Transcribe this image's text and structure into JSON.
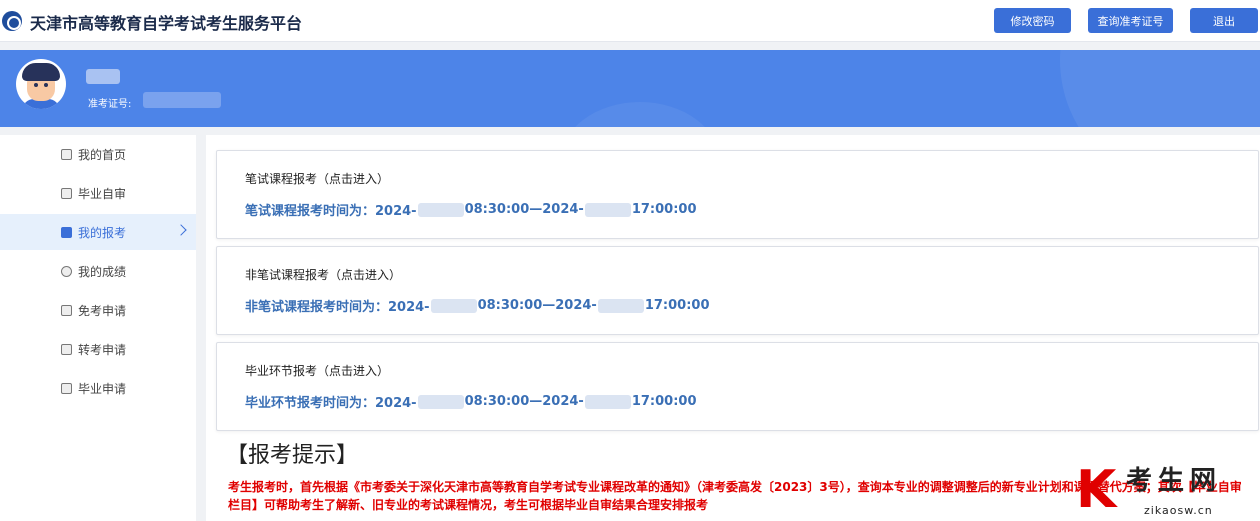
{
  "header": {
    "title": "天津市高等教育自学考试考生服务平台",
    "buttons": {
      "change_password": "修改密码",
      "query_ticket": "查询准考证号",
      "logout": "退出"
    }
  },
  "profile": {
    "ticket_label": "准考证号:"
  },
  "colors": {
    "brand_blue": "#4d84e8",
    "button_blue": "#3a6fd8",
    "link_blue": "#3a6fb5",
    "alert_red": "#e00000"
  },
  "sidebar": {
    "items": [
      {
        "label": "我的首页",
        "icon": "user-icon"
      },
      {
        "label": "毕业自审",
        "icon": "user-icon"
      },
      {
        "label": "我的报考",
        "icon": "form-icon",
        "active": true
      },
      {
        "label": "我的成绩",
        "icon": "medal-icon"
      },
      {
        "label": "免考申请",
        "icon": "doc-icon"
      },
      {
        "label": "转考申请",
        "icon": "doc-icon"
      },
      {
        "label": "毕业申请",
        "icon": "doc-icon"
      }
    ]
  },
  "cards": [
    {
      "title": "笔试课程报考（点击进入）",
      "time_prefix": "笔试课程报考时间为：2024-",
      "time_mid": "08:30:00—2024-",
      "time_end": "17:00:00"
    },
    {
      "title": "非笔试课程报考（点击进入）",
      "time_prefix": "非笔试课程报考时间为：2024-",
      "time_mid": "08:30:00—2024-",
      "time_end": "17:00:00"
    },
    {
      "title": "毕业环节报考（点击进入）",
      "time_prefix": "毕业环节报考时间为：2024-",
      "time_mid": "08:30:00—2024-",
      "time_end": "17:00:00"
    }
  ],
  "tips": {
    "title": "【报考提示】",
    "text": "考生报考时，首先根据《市考委关于深化天津市高等教育自学考试专业课程改革的通知》（津考委高发〔2023〕3号），查询本专业的调整调整后的新专业计划和课程替代方案；其次【毕业自审栏目】可帮助考生了解新、旧专业的考试课程情况，考生可根据毕业自审结果合理安排报考"
  },
  "watermark": {
    "letter": "K",
    "chinese": "考生网",
    "url": "zikaosw.cn"
  }
}
